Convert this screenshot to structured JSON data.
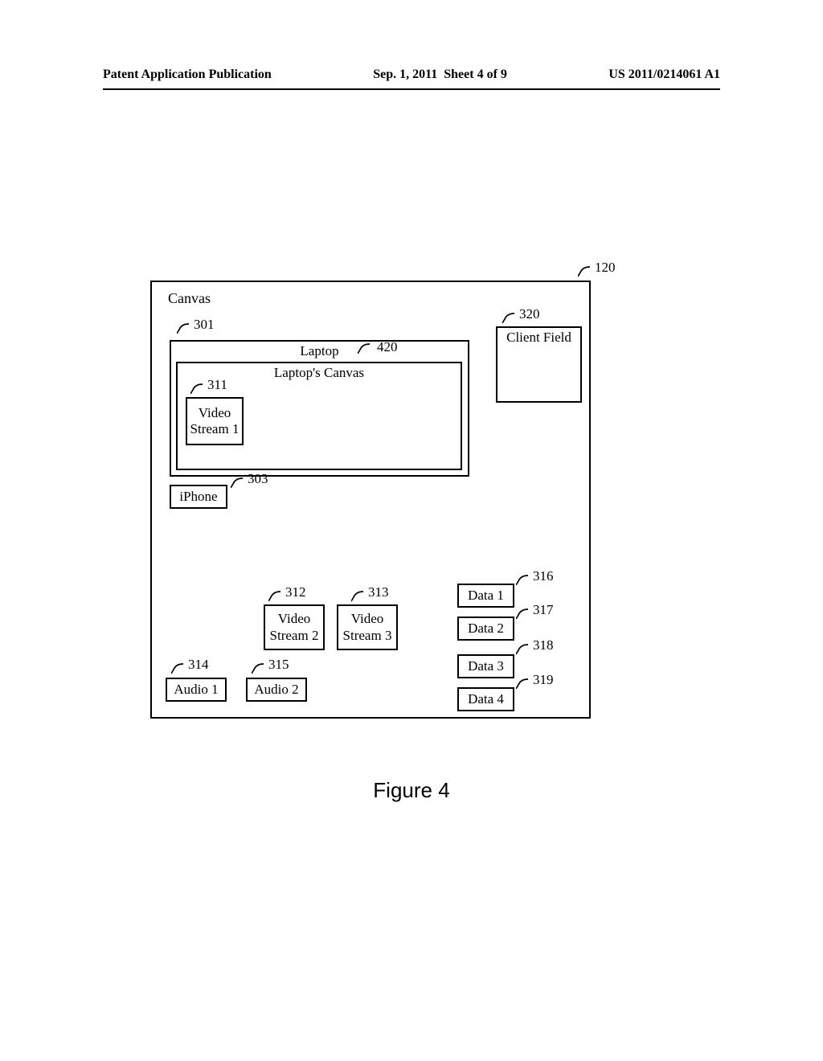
{
  "header": {
    "left": "Patent Application Publication",
    "center": "Sep. 1, 2011  Sheet 4 of 9",
    "right": "US 2011/0214061 A1"
  },
  "labels": {
    "canvas": "Canvas",
    "laptop": "Laptop",
    "laptops_canvas": "Laptop's Canvas",
    "video1": "Video\nStream 1",
    "iphone": "iPhone",
    "client_field": "Client Field",
    "video2": "Video\nStream 2",
    "video3": "Video\nStream 3",
    "audio1": "Audio 1",
    "audio2": "Audio 2",
    "data1": "Data 1",
    "data2": "Data 2",
    "data3": "Data 3",
    "data4": "Data 4"
  },
  "refs": {
    "r120": "120",
    "r301": "301",
    "r303": "303",
    "r311": "311",
    "r312": "312",
    "r313": "313",
    "r314": "314",
    "r315": "315",
    "r316": "316",
    "r317": "317",
    "r318": "318",
    "r319": "319",
    "r320": "320",
    "r420": "420"
  },
  "figure_caption": "Figure 4"
}
